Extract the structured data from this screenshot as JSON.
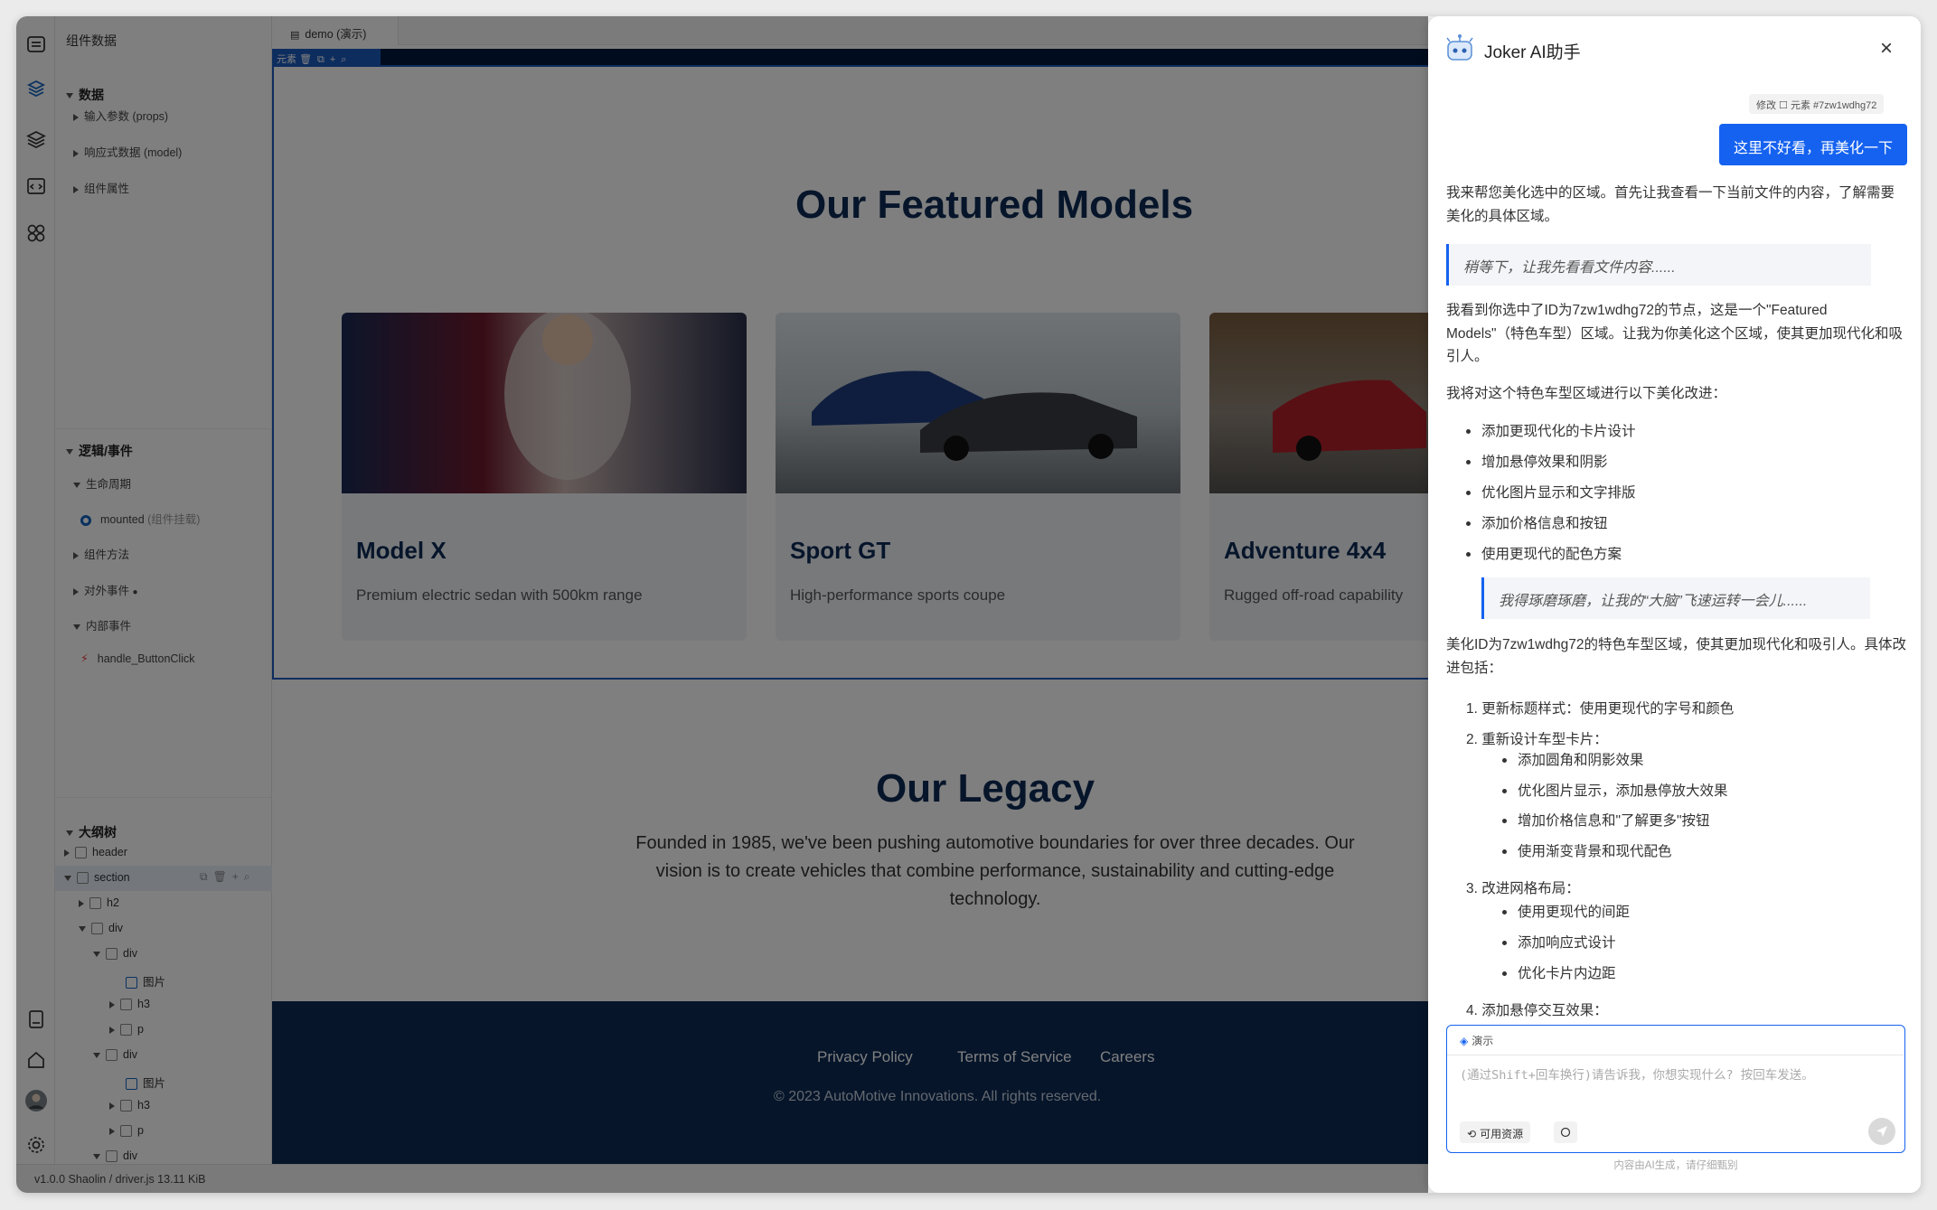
{
  "panel": {
    "title": "组件数据",
    "data_section": "数据",
    "data_items": [
      "输入参数 (props)",
      "响应式数据 (model)",
      "组件属性"
    ],
    "logic_section": "逻辑/事件",
    "lifecycle": "生命周期",
    "mounted": "mounted",
    "mounted_note": "(组件挂载)",
    "methods": "组件方法",
    "external_events": "对外事件",
    "internal_events": "内部事件",
    "handler": "handle_ButtonClick",
    "outline_section": "大纲树",
    "tree": [
      "header",
      "section",
      "h2",
      "div",
      "div",
      "图片",
      "h3",
      "p",
      "div",
      "图片",
      "h3",
      "p",
      "div"
    ]
  },
  "status": {
    "text": "v1.0.0   Shaolin / driver.js   13.11 KiB"
  },
  "canvas": {
    "tab": "demo (演示)",
    "sel_chip": "元素",
    "featured_title": "Our Featured Models",
    "cards": [
      {
        "title": "Model X",
        "desc": "Premium electric sedan with 500km range"
      },
      {
        "title": "Sport GT",
        "desc": "High-performance sports coupe"
      },
      {
        "title": "Adventure 4x4",
        "desc": "Rugged off-road capability"
      }
    ],
    "legacy_title": "Our Legacy",
    "legacy_text": "Founded in 1985, we've been pushing automotive boundaries for over three decades. Our vision is to create vehicles that combine performance, sustainability and cutting-edge technology.",
    "footer_links": [
      "Privacy Policy",
      "Terms of Service",
      "Careers"
    ],
    "copyright": "© 2023 AutoMotive Innovations. All rights reserved."
  },
  "ai": {
    "title": "Joker AI助手",
    "user_chip": "修改 ☐ 元素 #7zw1wdhg72",
    "user_msg": "这里不好看，再美化一下",
    "msg1": "我来帮您美化选中的区域。首先让我查看一下当前文件的内容，了解需要美化的具体区域。",
    "quote1": "稍等下，让我先看看文件内容......",
    "msg2": "我看到你选中了ID为7zw1wdhg72的节点，这是一个\"Featured Models\"（特色车型）区域。让我为你美化这个区域，使其更加现代化和吸引人。",
    "msg3": "我将对这个特色车型区域进行以下美化改进：",
    "bullets": [
      "添加更现代化的卡片设计",
      "增加悬停效果和阴影",
      "优化图片显示和文字排版",
      "添加价格信息和按钮",
      "使用更现代的配色方案"
    ],
    "quote2": "我得琢磨琢磨，让我的“大脑”飞速运转一会儿......",
    "msg4": "美化ID为7zw1wdhg72的特色车型区域，使其更加现代化和吸引人。具体改进包括：",
    "steps": [
      {
        "n": "1.",
        "text": "更新标题样式：使用更现代的字号和颜色",
        "subs": []
      },
      {
        "n": "2.",
        "text": "重新设计车型卡片：",
        "subs": [
          "添加圆角和阴影效果",
          "优化图片显示，添加悬停放大效果",
          "增加价格信息和\"了解更多\"按钮",
          "使用渐变背景和现代配色"
        ]
      },
      {
        "n": "3.",
        "text": "改进网格布局：",
        "subs": [
          "使用更现代的间距",
          "添加响应式设计",
          "优化卡片内边距"
        ]
      },
      {
        "n": "4.",
        "text": "添加悬停交互效果：",
        "subs": []
      }
    ],
    "input_tag": "演示",
    "placeholder": "(通过Shift+回车换行)请告诉我，你想实现什么? 按回车发送。",
    "resources": "可用资源",
    "disclaimer": "内容由AI生成，请仔细甄别"
  }
}
